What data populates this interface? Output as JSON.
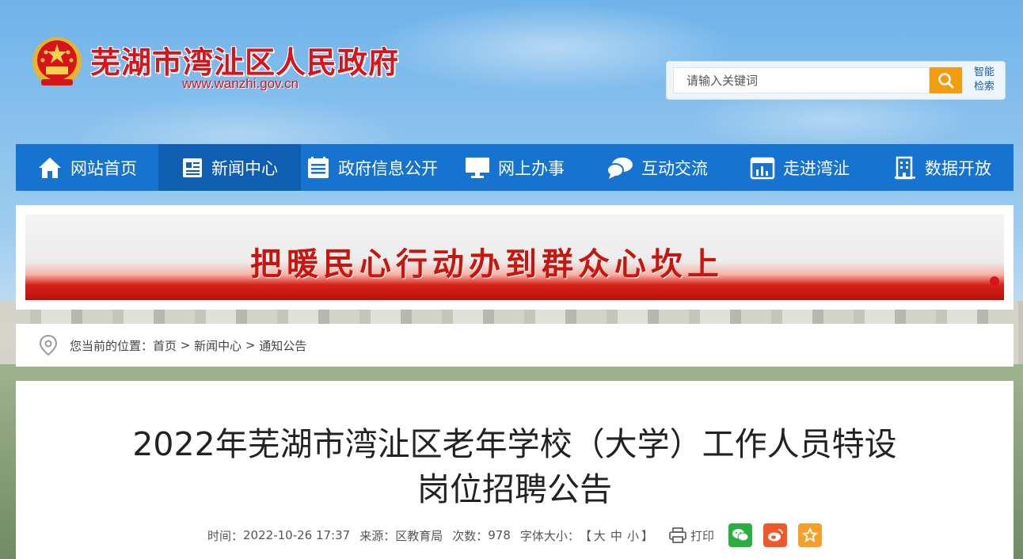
{
  "header": {
    "site_title": "芜湖市湾沚区人民政府",
    "site_url": "www.wanzhi.gov.cn",
    "search_placeholder": "请输入关键词",
    "smart_search_label": "智能检索"
  },
  "nav": {
    "items": [
      {
        "label": "网站首页",
        "icon": "home-icon"
      },
      {
        "label": "新闻中心",
        "icon": "news-icon",
        "active": true
      },
      {
        "label": "政府信息公开",
        "icon": "document-list-icon"
      },
      {
        "label": "网上办事",
        "icon": "monitor-icon"
      },
      {
        "label": "互动交流",
        "icon": "chat-bubble-icon"
      },
      {
        "label": "走进湾沚",
        "icon": "calendar-chart-icon"
      },
      {
        "label": "数据开放",
        "icon": "building-icon"
      }
    ]
  },
  "banner": {
    "slogan": "把暖民心行动办到群众心坎上"
  },
  "breadcrumb": {
    "prefix": "您当前的位置：",
    "items": [
      "首页",
      "新闻中心",
      "通知公告"
    ],
    "separator": " > "
  },
  "article": {
    "title_line1": "2022年芜湖市湾沚区老年学校（大学）工作人员特设",
    "title_line2": "岗位招聘公告",
    "time_label": "时间：",
    "time_value": "2022-10-26 17:37",
    "source_label": "来源：",
    "source_value": "区教育局",
    "views_label": "次数：",
    "views_value": "978",
    "font_size_label": "字体大小：",
    "font_size_open": "【",
    "font_size_large": "大",
    "font_size_medium": "中",
    "font_size_small": "小",
    "font_size_close": "】",
    "print_label": "打印"
  },
  "colors": {
    "brand_red": "#d7141a",
    "nav_blue": "#1673d0",
    "search_orange": "#f39c12",
    "wechat_green": "#2aae3f",
    "weibo_orange": "#f0572a",
    "favorite_orange": "#f6a02a"
  }
}
